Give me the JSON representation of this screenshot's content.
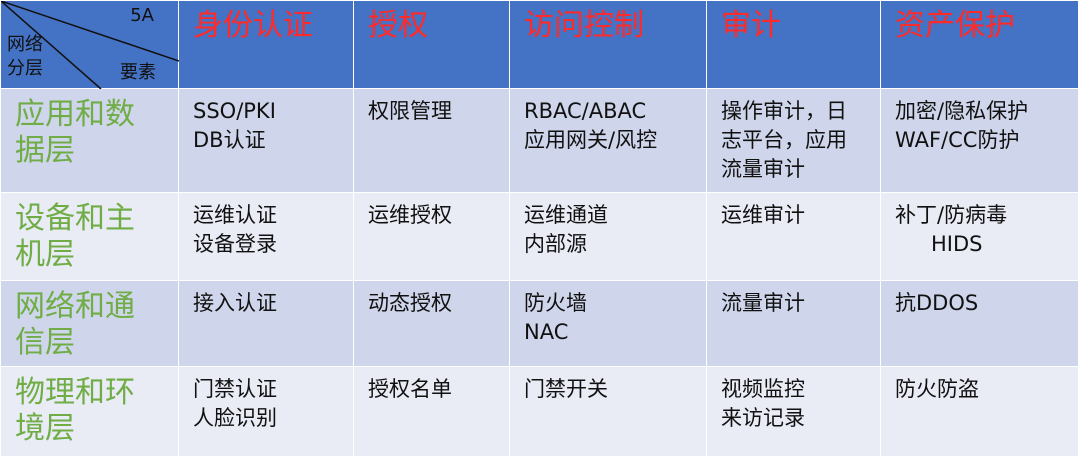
{
  "corner": {
    "top_right": "5A",
    "bottom_left_line1": "网络",
    "bottom_left_line2": "分层",
    "bottom_right": "要素"
  },
  "columns": [
    "身份认证",
    "授权",
    "访问控制",
    "审计",
    "资产保护"
  ],
  "rows": [
    {
      "label": "应用和数据层",
      "cells": [
        [
          "SSO/PKI",
          "DB认证"
        ],
        [
          "权限管理"
        ],
        [
          "RBAC/ABAC",
          "应用网关/风控"
        ],
        [
          "操作审计，日",
          "志平台，应用",
          "流量审计"
        ],
        [
          "加密/隐私保护",
          "WAF/CC防护"
        ]
      ]
    },
    {
      "label": "设备和主机层",
      "cells": [
        [
          "运维认证",
          "设备登录"
        ],
        [
          "运维授权"
        ],
        [
          "运维通道",
          "内部源"
        ],
        [
          "运维审计"
        ],
        [
          "补丁/防病毒",
          "HIDS"
        ]
      ]
    },
    {
      "label": "网络和通信层",
      "cells": [
        [
          "接入认证"
        ],
        [
          "动态授权"
        ],
        [
          "防火墙",
          "NAC"
        ],
        [
          "流量审计"
        ],
        [
          "抗DDOS"
        ]
      ]
    },
    {
      "label": "物理和环境层",
      "cells": [
        [
          "门禁认证",
          "人脸识别"
        ],
        [
          "授权名单"
        ],
        [
          "门禁开关"
        ],
        [
          "视频监控",
          "来访记录"
        ],
        [
          "防火防盗"
        ]
      ]
    }
  ]
}
